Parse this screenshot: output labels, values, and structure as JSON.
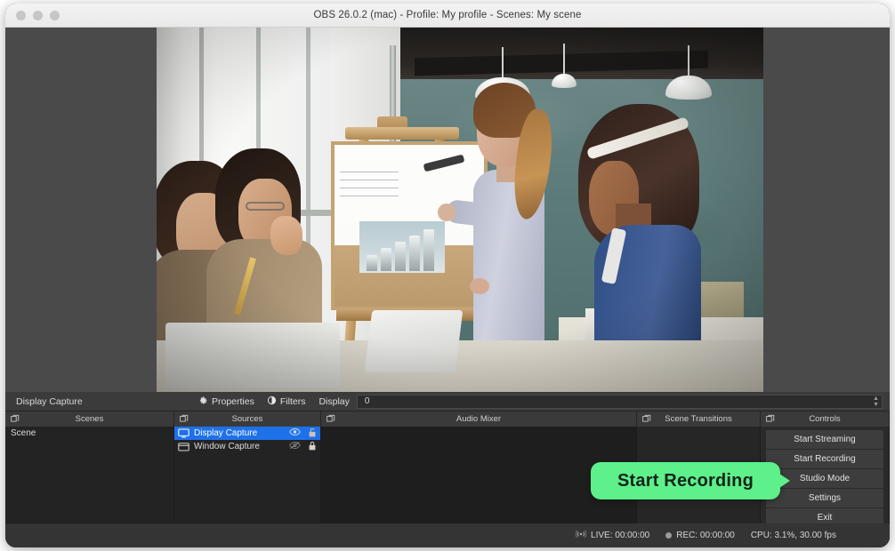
{
  "window": {
    "title": "OBS 26.0.2 (mac) - Profile: My profile - Scenes: My scene",
    "traffic_lights": [
      "close",
      "minimize",
      "maximize"
    ]
  },
  "source_toolbar": {
    "selected_source": "Display Capture",
    "properties_label": "Properties",
    "filters_label": "Filters",
    "display_label": "Display",
    "display_value": "0"
  },
  "docks": {
    "scenes": {
      "title": "Scenes",
      "items": [
        {
          "label": "Scene",
          "selected": true
        }
      ],
      "footer": [
        "+",
        "−",
        "∧",
        "∨"
      ]
    },
    "sources": {
      "title": "Sources",
      "items": [
        {
          "label": "Display Capture",
          "selected": true,
          "visible": true,
          "locked": false,
          "icon": "monitor-icon"
        },
        {
          "label": "Window Capture",
          "selected": false,
          "visible": false,
          "locked": true,
          "icon": "window-icon"
        }
      ],
      "footer": [
        "+",
        "−",
        "⚙",
        "∧",
        "∨"
      ]
    },
    "audio_mixer": {
      "title": "Audio Mixer"
    },
    "scene_transitions": {
      "title": "Scene Transitions"
    },
    "controls": {
      "title": "Controls",
      "buttons": [
        "Start Streaming",
        "Start Recording",
        "Studio Mode",
        "Settings",
        "Exit"
      ]
    }
  },
  "callout": {
    "text": "Start Recording",
    "color": "#5df08b"
  },
  "status_bar": {
    "live_label": "LIVE: 00:00:00",
    "rec_label": "REC: 00:00:00",
    "cpu_label": "CPU: 3.1%, 30.00 fps"
  },
  "preview": {
    "scene_description": "Classroom scene: presenter at easel with bar chart, students seated"
  }
}
